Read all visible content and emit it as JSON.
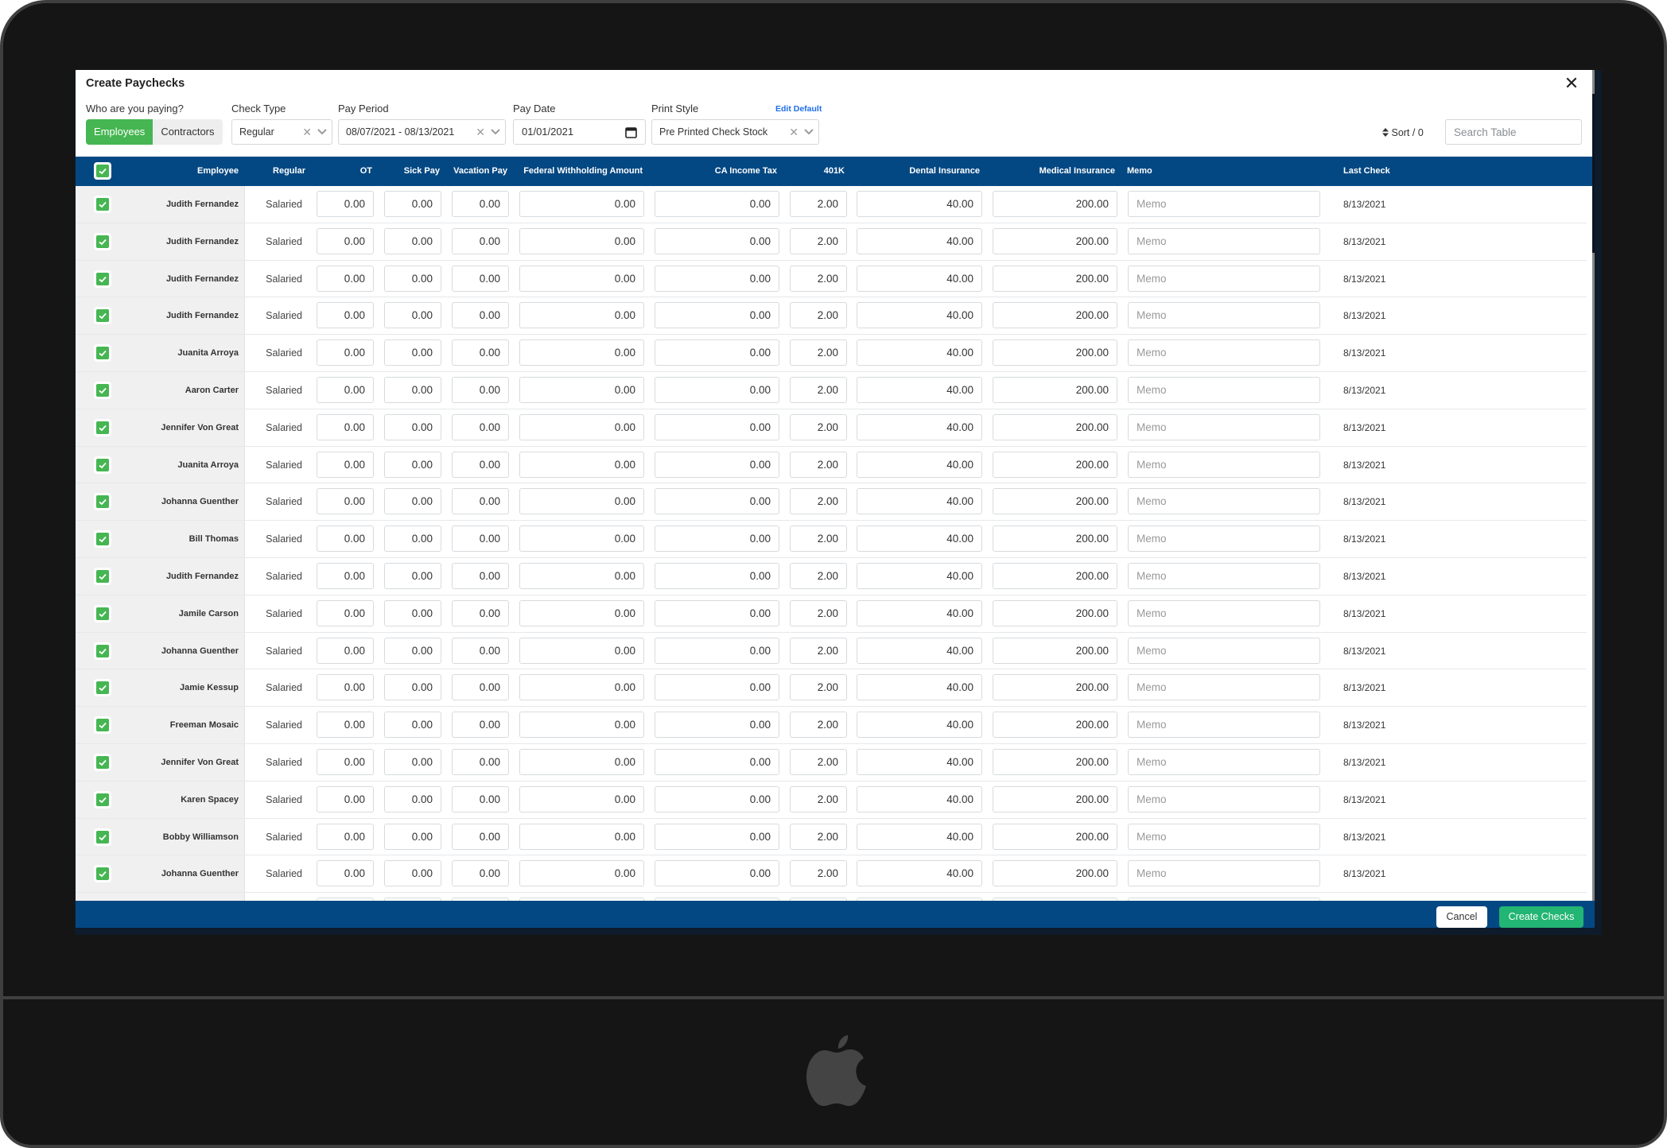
{
  "modal": {
    "title": "Create Paychecks",
    "close_icon": "close-icon"
  },
  "filters": {
    "who_label": "Who are you paying?",
    "who_options": [
      {
        "label": "Employees",
        "active": true
      },
      {
        "label": "Contractors",
        "active": false
      }
    ],
    "check_type": {
      "label": "Check Type",
      "value": "Regular"
    },
    "pay_period": {
      "label": "Pay Period",
      "value": "08/07/2021 - 08/13/2021"
    },
    "pay_date": {
      "label": "Pay Date",
      "value": "01/01/2021"
    },
    "print_style": {
      "label": "Print Style",
      "value": "Pre Printed Check Stock",
      "edit_link": "Edit Default"
    },
    "sort_label": "Sort / 0",
    "search_placeholder": "Search Table"
  },
  "table": {
    "columns": [
      "Employee",
      "Regular",
      "OT",
      "Sick Pay",
      "Vacation Pay",
      "Federal Withholding Amount",
      "CA Income Tax",
      "401K",
      "Dental Insurance",
      "Medical Insurance",
      "Memo",
      "Last Check"
    ],
    "select_all_checked": true,
    "memo_placeholder": "Memo",
    "rows": [
      {
        "checked": true,
        "employee": "Judith Fernandez",
        "regular": "Salaried",
        "ot": "0.00",
        "sick_pay": "0.00",
        "vacation_pay": "0.00",
        "federal_withholding": "0.00",
        "ca_income_tax": "0.00",
        "k401": "2.00",
        "dental": "40.00",
        "medical": "200.00",
        "memo": "",
        "last_check": "8/13/2021"
      },
      {
        "checked": true,
        "employee": "Judith Fernandez",
        "regular": "Salaried",
        "ot": "0.00",
        "sick_pay": "0.00",
        "vacation_pay": "0.00",
        "federal_withholding": "0.00",
        "ca_income_tax": "0.00",
        "k401": "2.00",
        "dental": "40.00",
        "medical": "200.00",
        "memo": "",
        "last_check": "8/13/2021"
      },
      {
        "checked": true,
        "employee": "Judith Fernandez",
        "regular": "Salaried",
        "ot": "0.00",
        "sick_pay": "0.00",
        "vacation_pay": "0.00",
        "federal_withholding": "0.00",
        "ca_income_tax": "0.00",
        "k401": "2.00",
        "dental": "40.00",
        "medical": "200.00",
        "memo": "",
        "last_check": "8/13/2021"
      },
      {
        "checked": true,
        "employee": "Judith Fernandez",
        "regular": "Salaried",
        "ot": "0.00",
        "sick_pay": "0.00",
        "vacation_pay": "0.00",
        "federal_withholding": "0.00",
        "ca_income_tax": "0.00",
        "k401": "2.00",
        "dental": "40.00",
        "medical": "200.00",
        "memo": "",
        "last_check": "8/13/2021"
      },
      {
        "checked": true,
        "employee": "Juanita Arroya",
        "regular": "Salaried",
        "ot": "0.00",
        "sick_pay": "0.00",
        "vacation_pay": "0.00",
        "federal_withholding": "0.00",
        "ca_income_tax": "0.00",
        "k401": "2.00",
        "dental": "40.00",
        "medical": "200.00",
        "memo": "",
        "last_check": "8/13/2021"
      },
      {
        "checked": true,
        "employee": "Aaron Carter",
        "regular": "Salaried",
        "ot": "0.00",
        "sick_pay": "0.00",
        "vacation_pay": "0.00",
        "federal_withholding": "0.00",
        "ca_income_tax": "0.00",
        "k401": "2.00",
        "dental": "40.00",
        "medical": "200.00",
        "memo": "",
        "last_check": "8/13/2021"
      },
      {
        "checked": true,
        "employee": "Jennifer Von Great",
        "regular": "Salaried",
        "ot": "0.00",
        "sick_pay": "0.00",
        "vacation_pay": "0.00",
        "federal_withholding": "0.00",
        "ca_income_tax": "0.00",
        "k401": "2.00",
        "dental": "40.00",
        "medical": "200.00",
        "memo": "",
        "last_check": "8/13/2021"
      },
      {
        "checked": true,
        "employee": "Juanita Arroya",
        "regular": "Salaried",
        "ot": "0.00",
        "sick_pay": "0.00",
        "vacation_pay": "0.00",
        "federal_withholding": "0.00",
        "ca_income_tax": "0.00",
        "k401": "2.00",
        "dental": "40.00",
        "medical": "200.00",
        "memo": "",
        "last_check": "8/13/2021"
      },
      {
        "checked": true,
        "employee": "Johanna Guenther",
        "regular": "Salaried",
        "ot": "0.00",
        "sick_pay": "0.00",
        "vacation_pay": "0.00",
        "federal_withholding": "0.00",
        "ca_income_tax": "0.00",
        "k401": "2.00",
        "dental": "40.00",
        "medical": "200.00",
        "memo": "",
        "last_check": "8/13/2021"
      },
      {
        "checked": true,
        "employee": "Bill Thomas",
        "regular": "Salaried",
        "ot": "0.00",
        "sick_pay": "0.00",
        "vacation_pay": "0.00",
        "federal_withholding": "0.00",
        "ca_income_tax": "0.00",
        "k401": "2.00",
        "dental": "40.00",
        "medical": "200.00",
        "memo": "",
        "last_check": "8/13/2021"
      },
      {
        "checked": true,
        "employee": "Judith Fernandez",
        "regular": "Salaried",
        "ot": "0.00",
        "sick_pay": "0.00",
        "vacation_pay": "0.00",
        "federal_withholding": "0.00",
        "ca_income_tax": "0.00",
        "k401": "2.00",
        "dental": "40.00",
        "medical": "200.00",
        "memo": "",
        "last_check": "8/13/2021"
      },
      {
        "checked": true,
        "employee": "Jamile Carson",
        "regular": "Salaried",
        "ot": "0.00",
        "sick_pay": "0.00",
        "vacation_pay": "0.00",
        "federal_withholding": "0.00",
        "ca_income_tax": "0.00",
        "k401": "2.00",
        "dental": "40.00",
        "medical": "200.00",
        "memo": "",
        "last_check": "8/13/2021"
      },
      {
        "checked": true,
        "employee": "Johanna Guenther",
        "regular": "Salaried",
        "ot": "0.00",
        "sick_pay": "0.00",
        "vacation_pay": "0.00",
        "federal_withholding": "0.00",
        "ca_income_tax": "0.00",
        "k401": "2.00",
        "dental": "40.00",
        "medical": "200.00",
        "memo": "",
        "last_check": "8/13/2021"
      },
      {
        "checked": true,
        "employee": "Jamie Kessup",
        "regular": "Salaried",
        "ot": "0.00",
        "sick_pay": "0.00",
        "vacation_pay": "0.00",
        "federal_withholding": "0.00",
        "ca_income_tax": "0.00",
        "k401": "2.00",
        "dental": "40.00",
        "medical": "200.00",
        "memo": "",
        "last_check": "8/13/2021"
      },
      {
        "checked": true,
        "employee": "Freeman Mosaic",
        "regular": "Salaried",
        "ot": "0.00",
        "sick_pay": "0.00",
        "vacation_pay": "0.00",
        "federal_withholding": "0.00",
        "ca_income_tax": "0.00",
        "k401": "2.00",
        "dental": "40.00",
        "medical": "200.00",
        "memo": "",
        "last_check": "8/13/2021"
      },
      {
        "checked": true,
        "employee": "Jennifer Von Great",
        "regular": "Salaried",
        "ot": "0.00",
        "sick_pay": "0.00",
        "vacation_pay": "0.00",
        "federal_withholding": "0.00",
        "ca_income_tax": "0.00",
        "k401": "2.00",
        "dental": "40.00",
        "medical": "200.00",
        "memo": "",
        "last_check": "8/13/2021"
      },
      {
        "checked": true,
        "employee": "Karen Spacey",
        "regular": "Salaried",
        "ot": "0.00",
        "sick_pay": "0.00",
        "vacation_pay": "0.00",
        "federal_withholding": "0.00",
        "ca_income_tax": "0.00",
        "k401": "2.00",
        "dental": "40.00",
        "medical": "200.00",
        "memo": "",
        "last_check": "8/13/2021"
      },
      {
        "checked": true,
        "employee": "Bobby Williamson",
        "regular": "Salaried",
        "ot": "0.00",
        "sick_pay": "0.00",
        "vacation_pay": "0.00",
        "federal_withholding": "0.00",
        "ca_income_tax": "0.00",
        "k401": "2.00",
        "dental": "40.00",
        "medical": "200.00",
        "memo": "",
        "last_check": "8/13/2021"
      },
      {
        "checked": true,
        "employee": "Johanna Guenther",
        "regular": "Salaried",
        "ot": "0.00",
        "sick_pay": "0.00",
        "vacation_pay": "0.00",
        "federal_withholding": "0.00",
        "ca_income_tax": "0.00",
        "k401": "2.00",
        "dental": "40.00",
        "medical": "200.00",
        "memo": "",
        "last_check": "8/13/2021"
      }
    ]
  },
  "footer": {
    "cancel_label": "Cancel",
    "create_label": "Create Checks"
  },
  "colors": {
    "header_blue": "#044883",
    "check_green": "#46b652",
    "create_green": "#22b573",
    "link_blue": "#1e6ee8"
  }
}
